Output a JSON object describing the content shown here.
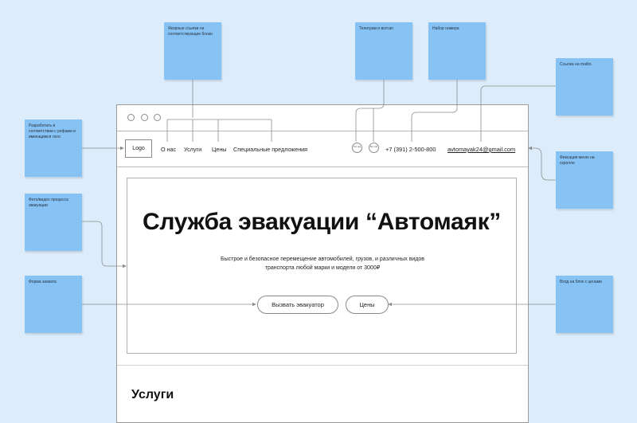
{
  "notes": {
    "anchor_links": "Якорные ссылки на соответствующие блоки",
    "telegram_whatsapp": "Телеграм и вотсап",
    "dial_number": "Набор номера",
    "mail_link": "Ссылка на mailto.",
    "logo_dev": "Разработать в соответствии с рефами и имеющимся лого",
    "fixed_menu": "Фиксация меню на скролле",
    "photo_video": "Фото/видео процесса эвакуации",
    "capture_form": "Форма захвата",
    "prices_jump": "Вход на блок с ценами"
  },
  "mockup": {
    "logo": "Logo",
    "nav": [
      "О нас",
      "Услуги",
      "Цены",
      "Специальные предложения"
    ],
    "social": [
      {
        "label": "Тел грм",
        "icon": "telegram-icon"
      },
      {
        "label": "Вот сап",
        "icon": "whatsapp-icon"
      }
    ],
    "phone": "+7 (391) 2-500-800",
    "email": "avtomayak24@gmail.com",
    "hero": {
      "title": "Служба эвакуации “Автомаяк”",
      "subtitle": "Быстрое и безопасное перемещение автомобилей, грузов, и различных видов транспорта любой марки и модели от 3000₽",
      "primary_button": "Вызвать эвакуатор",
      "secondary_button": "Цены"
    },
    "services_title": "Услуги"
  },
  "colors": {
    "background": "#dcecfb",
    "sticky": "#87c2f4",
    "connector": "#8e8e8e"
  }
}
